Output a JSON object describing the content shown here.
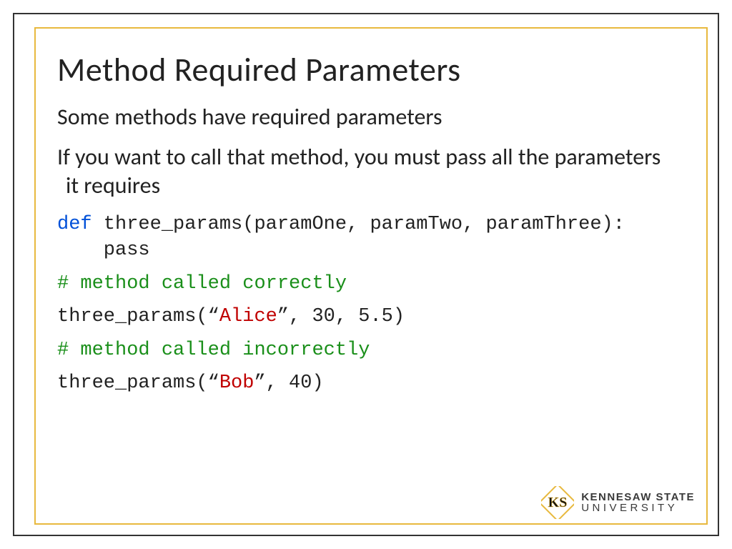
{
  "title": "Method Required Parameters",
  "body": {
    "line1": "Some methods have required parameters",
    "line2": "If you want to call that method, you must pass all the parameters it requires"
  },
  "code": {
    "def_kw": "def",
    "def_sig": " three_params(paramOne, paramTwo, paramThree):",
    "def_body": "    pass",
    "comment_correct": "# method called correctly",
    "call_correct_pre": "three_params(“",
    "call_correct_str": "Alice",
    "call_correct_post": "”, 30, 5.5)",
    "comment_incorrect": "# method called incorrectly",
    "call_incorrect_pre": "three_params(“",
    "call_incorrect_str": "Bob",
    "call_incorrect_post": "”, 40)"
  },
  "logo": {
    "line1": "KENNESAW STATE",
    "line2": "UNIVERSITY"
  }
}
